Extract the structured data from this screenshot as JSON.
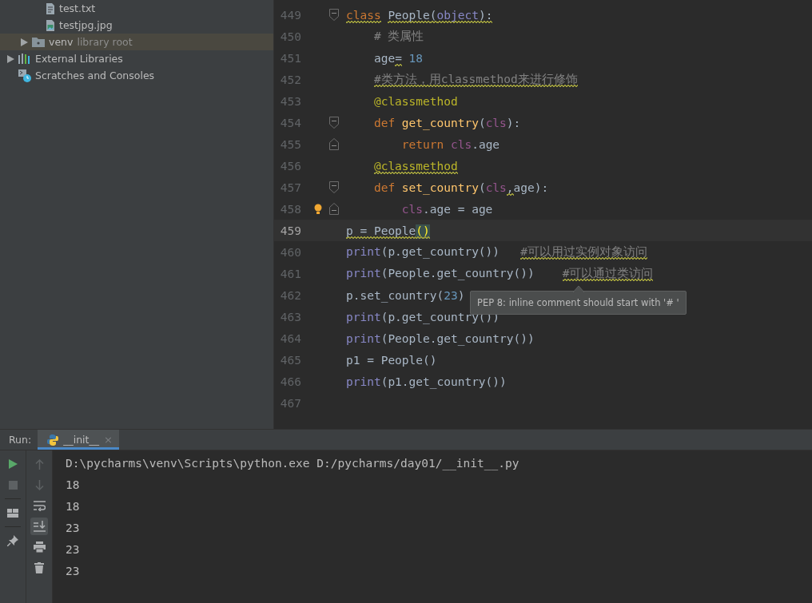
{
  "project_tree": {
    "items": [
      {
        "children": [
          {
            "children": [
              {
                "label": "test.txt",
                "kind": "text-file",
                "selected": false
              },
              {
                "label": "testjpg.jpg",
                "kind": "image-file",
                "selected": false
              }
            ]
          },
          {
            "label": "venv",
            "hint": "library root",
            "kind": "folder",
            "expanded": false,
            "selected": true
          }
        ]
      },
      {
        "label": "External Libraries",
        "kind": "library",
        "expanded": false,
        "selected": false
      },
      {
        "label": "Scratches and Consoles",
        "kind": "scratches",
        "selected": false
      }
    ]
  },
  "editor": {
    "lines": [
      {
        "number": "449",
        "current": false,
        "fold_start": true,
        "fold_end": false,
        "bulb": false,
        "tokens": [
          {
            "text": "class",
            "kind": "keyword",
            "warn": true
          },
          {
            "text": " People",
            "kind": "plain",
            "warn": true
          },
          {
            "text": "(",
            "kind": "plain",
            "warn": true
          },
          {
            "text": "object",
            "kind": "builtin",
            "warn": true
          },
          {
            "text": "):",
            "kind": "plain",
            "warn": true
          }
        ]
      },
      {
        "number": "450",
        "current": false,
        "fold_start": false,
        "fold_end": false,
        "bulb": false,
        "tokens": [
          {
            "text": "    # 类属性",
            "kind": "comment",
            "warn": false
          }
        ]
      },
      {
        "number": "451",
        "current": false,
        "fold_start": false,
        "fold_end": false,
        "bulb": false,
        "tokens": [
          {
            "text": "    age",
            "kind": "plain",
            "warn": false
          },
          {
            "text": "=",
            "kind": "plain",
            "warn": true
          },
          {
            "text": " 18",
            "kind": "number",
            "warn": false
          }
        ]
      },
      {
        "number": "452",
        "current": false,
        "fold_start": false,
        "fold_end": false,
        "bulb": false,
        "tokens": [
          {
            "text": "    #类方法，用classmethod来进行修饰",
            "kind": "comment",
            "warn": true
          }
        ]
      },
      {
        "number": "453",
        "current": false,
        "fold_start": false,
        "fold_end": false,
        "bulb": false,
        "tokens": [
          {
            "text": "    @classmethod",
            "kind": "decorator",
            "warn": false
          }
        ]
      },
      {
        "number": "454",
        "current": false,
        "fold_start": true,
        "fold_end": false,
        "bulb": false,
        "tokens": [
          {
            "text": "    def",
            "kind": "keyword",
            "warn": false
          },
          {
            "text": " get_country",
            "kind": "func",
            "warn": false
          },
          {
            "text": "(",
            "kind": "plain",
            "warn": false
          },
          {
            "text": "cls",
            "kind": "self",
            "warn": false
          },
          {
            "text": "):",
            "kind": "plain",
            "warn": false
          }
        ]
      },
      {
        "number": "455",
        "current": false,
        "fold_start": false,
        "fold_end": true,
        "bulb": false,
        "tokens": [
          {
            "text": "        return",
            "kind": "keyword",
            "warn": false
          },
          {
            "text": " cls",
            "kind": "self",
            "warn": false
          },
          {
            "text": ".age",
            "kind": "plain",
            "warn": false
          }
        ]
      },
      {
        "number": "456",
        "current": false,
        "fold_start": false,
        "fold_end": false,
        "bulb": false,
        "tokens": [
          {
            "text": "    @classmethod",
            "kind": "decorator",
            "warn": true
          }
        ]
      },
      {
        "number": "457",
        "current": false,
        "fold_start": true,
        "fold_end": false,
        "bulb": false,
        "tokens": [
          {
            "text": "    def",
            "kind": "keyword",
            "warn": false
          },
          {
            "text": " set_country",
            "kind": "func",
            "warn": false
          },
          {
            "text": "(",
            "kind": "plain",
            "warn": false
          },
          {
            "text": "cls",
            "kind": "self",
            "warn": false
          },
          {
            "text": ",",
            "kind": "plain",
            "warn": true
          },
          {
            "text": "age):",
            "kind": "plain",
            "warn": false
          }
        ]
      },
      {
        "number": "458",
        "current": false,
        "fold_start": false,
        "fold_end": true,
        "bulb": true,
        "tokens": [
          {
            "text": "        cls",
            "kind": "self",
            "warn": false
          },
          {
            "text": ".age = age",
            "kind": "plain",
            "warn": false
          }
        ]
      },
      {
        "number": "459",
        "current": true,
        "fold_start": false,
        "fold_end": false,
        "bulb": false,
        "tokens": [
          {
            "text": "p = People",
            "kind": "plain",
            "warn": true
          },
          {
            "text": "(",
            "kind": "match",
            "warn": true
          },
          {
            "text": ")",
            "kind": "match",
            "warn": true
          }
        ]
      },
      {
        "number": "460",
        "current": false,
        "fold_start": false,
        "fold_end": false,
        "bulb": false,
        "tokens": [
          {
            "text": "print",
            "kind": "builtin",
            "warn": false
          },
          {
            "text": "(p.get_country())",
            "kind": "plain",
            "warn": false
          },
          {
            "text": "   #可以用过实例对象访问",
            "kind": "comment",
            "warn": true
          }
        ]
      },
      {
        "number": "461",
        "current": false,
        "fold_start": false,
        "fold_end": false,
        "bulb": false,
        "tokens": [
          {
            "text": "print",
            "kind": "builtin",
            "warn": false
          },
          {
            "text": "(People.get_country())",
            "kind": "plain",
            "warn": false
          },
          {
            "text": "    #可以通过类访问",
            "kind": "comment",
            "warn": true
          }
        ]
      },
      {
        "number": "462",
        "current": false,
        "fold_start": false,
        "fold_end": false,
        "bulb": false,
        "tokens": [
          {
            "text": "p.set_country(",
            "kind": "plain",
            "warn": false
          },
          {
            "text": "23",
            "kind": "number",
            "warn": false
          },
          {
            "text": ")",
            "kind": "plain",
            "warn": false
          }
        ]
      },
      {
        "number": "463",
        "current": false,
        "fold_start": false,
        "fold_end": false,
        "bulb": false,
        "tokens": [
          {
            "text": "print",
            "kind": "builtin",
            "warn": false
          },
          {
            "text": "(p.get_country())",
            "kind": "plain",
            "warn": false
          }
        ]
      },
      {
        "number": "464",
        "current": false,
        "fold_start": false,
        "fold_end": false,
        "bulb": false,
        "tokens": [
          {
            "text": "print",
            "kind": "builtin",
            "warn": false
          },
          {
            "text": "(People.get_country())",
            "kind": "plain",
            "warn": false
          }
        ]
      },
      {
        "number": "465",
        "current": false,
        "fold_start": false,
        "fold_end": false,
        "bulb": false,
        "tokens": [
          {
            "text": "p1 = People()",
            "kind": "plain",
            "warn": false
          }
        ]
      },
      {
        "number": "466",
        "current": false,
        "fold_start": false,
        "fold_end": false,
        "bulb": false,
        "tokens": [
          {
            "text": "print",
            "kind": "builtin",
            "warn": false
          },
          {
            "text": "(p1.get_country())",
            "kind": "plain",
            "warn": false
          }
        ]
      },
      {
        "number": "467",
        "current": false,
        "fold_start": false,
        "fold_end": false,
        "bulb": false
      }
    ],
    "tooltip": "PEP 8: inline comment should start with '# '"
  },
  "run_panel": {
    "label": "Run:",
    "tabs": [
      {
        "title": "__init__",
        "close": "×",
        "selected": true
      }
    ],
    "toolbar_left": [
      {
        "kind": "run",
        "disabled": false
      },
      {
        "kind": "stop",
        "disabled": true
      },
      {
        "kind": "layout",
        "disabled": false
      },
      {
        "kind": "pin",
        "disabled": false
      }
    ],
    "toolbar_right": [
      {
        "kind": "up",
        "disabled": true,
        "selected": false
      },
      {
        "kind": "down",
        "disabled": true,
        "selected": false
      },
      {
        "kind": "wrap",
        "disabled": false,
        "selected": false
      },
      {
        "kind": "scroll-end",
        "disabled": false,
        "selected": true
      },
      {
        "kind": "print",
        "disabled": false,
        "selected": false
      },
      {
        "kind": "trash",
        "disabled": false,
        "selected": false
      }
    ],
    "output": [
      "D:\\pycharms\\venv\\Scripts\\python.exe D:/pycharms/day01/__init__.py",
      "18",
      "18",
      "23",
      "23",
      "23"
    ]
  }
}
